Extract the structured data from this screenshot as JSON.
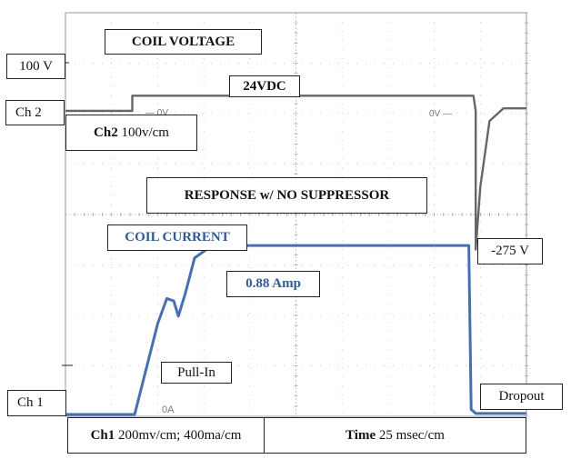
{
  "chart_data": {
    "type": "line",
    "title": "RESPONSE w/ NO SUPPRESSOR",
    "grid": true,
    "grid_divisions": {
      "x": 10,
      "y": 8
    },
    "xlabel": "Time 25 msec/cm",
    "time_per_div_ms": 25,
    "series": [
      {
        "name": "COIL VOLTAGE",
        "channel": "Ch 2",
        "scale": "100v/cm",
        "color": "#555555",
        "points_div": [
          [
            0,
            0
          ],
          [
            1.45,
            0
          ],
          [
            1.45,
            0.3
          ],
          [
            8.85,
            0.3
          ],
          [
            8.9,
            0
          ],
          [
            8.9,
            -2.75
          ],
          [
            9.0,
            -1.5
          ],
          [
            9.2,
            -0.2
          ],
          [
            9.5,
            0.05
          ],
          [
            10,
            0.05
          ]
        ],
        "annotations": {
          "steady": "24VDC",
          "peak": "-275 V",
          "zero": "0V"
        }
      },
      {
        "name": "COIL CURRENT",
        "channel": "Ch 1",
        "scale": "200mv/cm; 400ma/cm",
        "color": "#2f5fb8",
        "points_div": [
          [
            0,
            0
          ],
          [
            1.5,
            0
          ],
          [
            2.0,
            1.8
          ],
          [
            2.2,
            2.3
          ],
          [
            2.35,
            2.25
          ],
          [
            2.45,
            1.95
          ],
          [
            2.6,
            2.4
          ],
          [
            2.8,
            3.1
          ],
          [
            3.1,
            3.3
          ],
          [
            4,
            3.35
          ],
          [
            8.75,
            3.35
          ],
          [
            8.8,
            0.1
          ],
          [
            8.9,
            0.02
          ],
          [
            10,
            0.02
          ]
        ],
        "annotations": {
          "steady": "0.88 Amp",
          "dip": "Pull-In",
          "release": "Dropout",
          "zero": "0A"
        }
      }
    ],
    "labels": {
      "coil_voltage": "COIL VOLTAGE",
      "voltage_steady": "24VDC",
      "voltage_peak": "-275 V",
      "volts_marker": "100 V",
      "ch2": "Ch 2",
      "ch2_scale_bold": "Ch2",
      "ch2_scale": "100v/cm",
      "title": "RESPONSE w/ NO SUPPRESSOR",
      "coil_current": "COIL CURRENT",
      "current_steady": "0.88 Amp",
      "pull_in": "Pull-In",
      "ch1": "Ch 1",
      "dropout": "Dropout",
      "ch1_scale_bold": "Ch1",
      "ch1_scale": "200mv/cm; 400ma/cm",
      "time_bold": "Time",
      "time_scale": "25 msec/cm",
      "zero_v": "0V",
      "zero_a": "0A"
    }
  }
}
